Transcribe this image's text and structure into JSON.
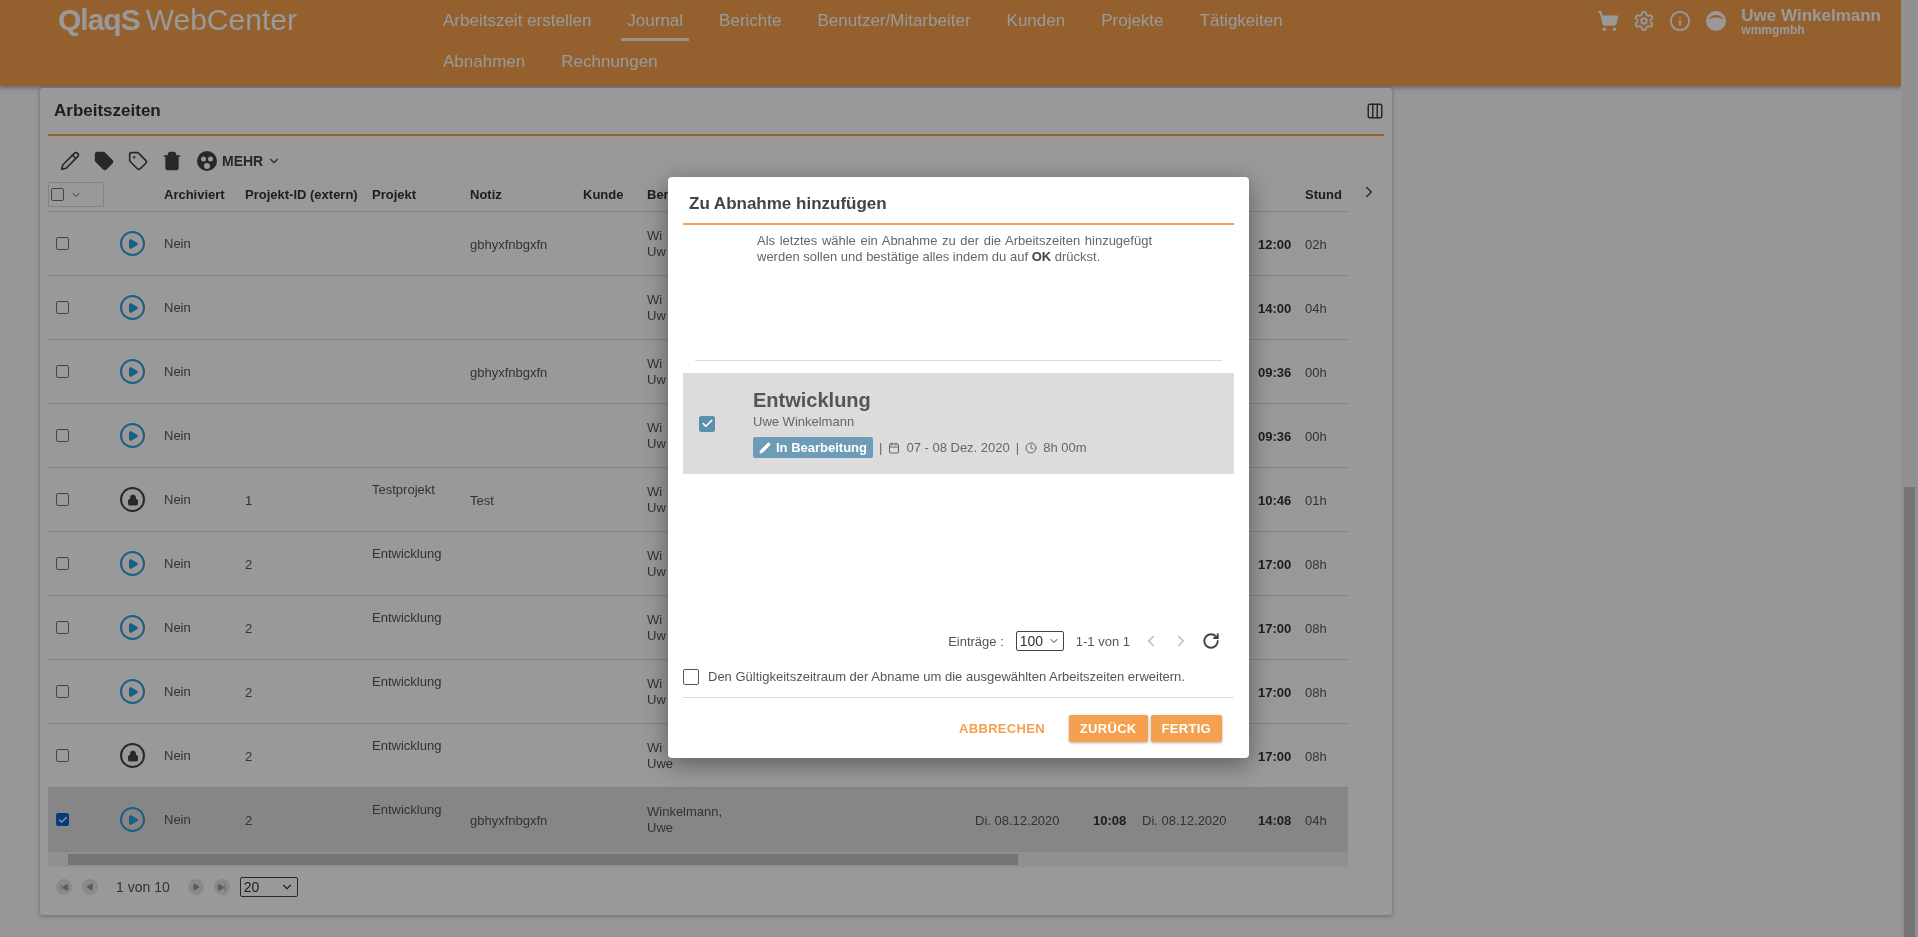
{
  "header": {
    "logo_mark": "QlaqS",
    "logo_text": "WebCenter",
    "nav": [
      {
        "label": "Arbeitszeit erstellen",
        "selected": false
      },
      {
        "label": "Journal",
        "selected": true
      },
      {
        "label": "Berichte",
        "selected": false
      },
      {
        "label": "Benutzer/Mitarbeiter",
        "selected": false
      },
      {
        "label": "Kunden",
        "selected": false
      },
      {
        "label": "Projekte",
        "selected": false
      },
      {
        "label": "Tätigkeiten",
        "selected": false
      },
      {
        "label": "Abnahmen",
        "selected": false
      },
      {
        "label": "Rechnungen",
        "selected": false
      }
    ],
    "user": {
      "name": "Uwe Winkelmann",
      "company": "wmmgmbh"
    }
  },
  "panel": {
    "title": "Arbeitszeiten",
    "more": "MEHR",
    "select_all_checked": false,
    "columns": {
      "archiviert": "Archiviert",
      "projekt_id": "Projekt-ID (extern)",
      "projekt": "Projekt",
      "notiz": "Notiz",
      "kunde": "Kunde",
      "bearbeiter": "Ber",
      "stunden": "Stund"
    },
    "rows": [
      {
        "selected": false,
        "locked": false,
        "archiviert": "Nein",
        "notiz": "gbhyxfnbgxfn",
        "bearbeiter": [
          "Wi",
          "Uw"
        ],
        "ende": "12:00",
        "stunden": "02h"
      },
      {
        "selected": false,
        "locked": false,
        "archiviert": "Nein",
        "bearbeiter": [
          "Wi",
          "Uw"
        ],
        "ende": "14:00",
        "stunden": "04h"
      },
      {
        "selected": false,
        "locked": false,
        "archiviert": "Nein",
        "notiz": "gbhyxfnbgxfn",
        "bearbeiter": [
          "Wi",
          "Uw"
        ],
        "ende": "09:36",
        "stunden": "00h"
      },
      {
        "selected": false,
        "locked": false,
        "archiviert": "Nein",
        "bearbeiter": [
          "Wi",
          "Uw"
        ],
        "ende": "09:36",
        "stunden": "00h"
      },
      {
        "selected": false,
        "locked": true,
        "archiviert": "Nein",
        "projekt_id": "1",
        "projekt": "Testprojekt",
        "notiz": "Test",
        "bearbeiter": [
          "Wi",
          "Uw"
        ],
        "ende": "10:46",
        "stunden": "01h"
      },
      {
        "selected": false,
        "locked": false,
        "archiviert": "Nein",
        "projekt_id": "2",
        "projekt": "Entwicklung",
        "bearbeiter": [
          "Wi",
          "Uw"
        ],
        "ende": "17:00",
        "stunden": "08h"
      },
      {
        "selected": false,
        "locked": false,
        "archiviert": "Nein",
        "projekt_id": "2",
        "projekt": "Entwicklung",
        "bearbeiter": [
          "Wi",
          "Uw"
        ],
        "ende": "17:00",
        "stunden": "08h"
      },
      {
        "selected": false,
        "locked": false,
        "archiviert": "Nein",
        "projekt_id": "2",
        "projekt": "Entwicklung",
        "bearbeiter": [
          "Wi",
          "Uw"
        ],
        "ende": "17:00",
        "stunden": "08h"
      },
      {
        "selected": false,
        "locked": true,
        "archiviert": "Nein",
        "projekt_id": "2",
        "projekt": "Entwicklung",
        "bearbeiter": [
          "Wi",
          "Uwe"
        ],
        "ende": "17:00",
        "stunden": "08h"
      },
      {
        "selected": true,
        "locked": false,
        "archiviert": "Nein",
        "projekt_id": "2",
        "projekt": "Entwicklung",
        "notiz": "gbhyxfnbgxfn",
        "bearbeiter": [
          "Winkelmann,",
          "Uwe"
        ],
        "datum_von": "Di. 08.12.2020",
        "start": "10:08",
        "datum_bis": "Di. 08.12.2020",
        "ende": "14:08",
        "stunden": "04h"
      }
    ],
    "pagination": {
      "page": "1 von 10",
      "page_size": "20"
    }
  },
  "dialog": {
    "title": "Zu Abnahme hinzufügen",
    "message": "Als letztes wähle ein Abnahme zu der die Arbeitszeiten hinzugefügt werden sollen und bestätige alles indem du auf **OK** drückst.",
    "items": [
      {
        "selected": true,
        "title": "Entwicklung",
        "person": "Uwe Winkelmann",
        "status": "In Bearbeitung",
        "separators": [
          "|",
          "|"
        ],
        "dates": "07 - 08 Dez. 2020",
        "duration": "8h 00m"
      }
    ],
    "pagination": {
      "label": "Einträge :",
      "page_size": "100",
      "range": "1-1 von 1"
    },
    "extend": {
      "label": "Den Gültigkeitszeitraum der Abname um die ausgewählten Arbeitszeiten erweitern.",
      "checked": false
    },
    "buttons": [
      {
        "label": "ABBRECHEN",
        "kind": "text"
      },
      {
        "label": "ZURÜCK",
        "kind": "filled"
      },
      {
        "label": "FERTIG",
        "kind": "filled"
      }
    ]
  }
}
